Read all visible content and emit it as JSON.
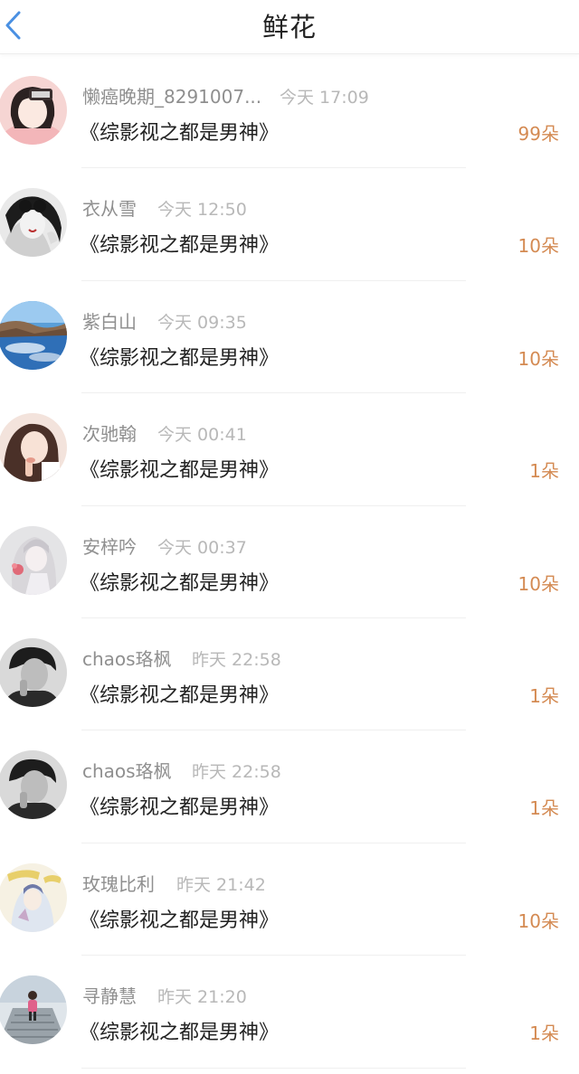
{
  "header": {
    "title": "鲜花",
    "back_icon": "chevron-left-icon",
    "accent_color": "#4a90e2"
  },
  "colors": {
    "amount": "#d48a52",
    "name": "#8f8f8f",
    "time": "#b8b8b8"
  },
  "items": [
    {
      "name": "懒癌晚期_8291007...",
      "time": "今天 17:09",
      "book": "《综影视之都是男神》",
      "amount": "99朵"
    },
    {
      "name": "衣从雪",
      "time": "今天 12:50",
      "book": "《综影视之都是男神》",
      "amount": "10朵"
    },
    {
      "name": "紫白山",
      "time": "今天 09:35",
      "book": "《综影视之都是男神》",
      "amount": "10朵"
    },
    {
      "name": "次驰翰",
      "time": "今天 00:41",
      "book": "《综影视之都是男神》",
      "amount": "1朵"
    },
    {
      "name": "安梓吟",
      "time": "今天 00:37",
      "book": "《综影视之都是男神》",
      "amount": "10朵"
    },
    {
      "name": "chaos珞枫",
      "time": "昨天 22:58",
      "book": "《综影视之都是男神》",
      "amount": "1朵"
    },
    {
      "name": "chaos珞枫",
      "time": "昨天 22:58",
      "book": "《综影视之都是男神》",
      "amount": "1朵"
    },
    {
      "name": "玫瑰比利",
      "time": "昨天 21:42",
      "book": "《综影视之都是男神》",
      "amount": "10朵"
    },
    {
      "name": "寻静慧",
      "time": "昨天 21:20",
      "book": "《综影视之都是男神》",
      "amount": "1朵"
    }
  ]
}
